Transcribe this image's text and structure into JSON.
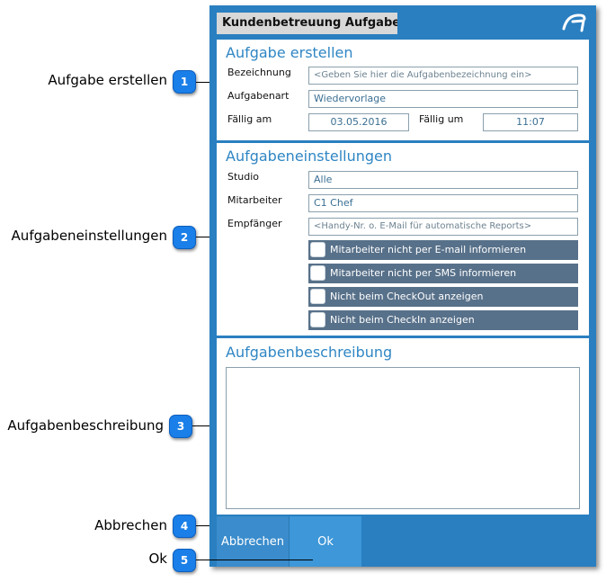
{
  "window": {
    "title": "Kundenbetreuung Aufgabe"
  },
  "callouts": [
    {
      "num": "1",
      "label": "Aufgabe erstellen"
    },
    {
      "num": "2",
      "label": "Aufgabeneinstellungen"
    },
    {
      "num": "3",
      "label": "Aufgabenbeschreibung"
    },
    {
      "num": "4",
      "label": "Abbrechen"
    },
    {
      "num": "5",
      "label": "Ok"
    }
  ],
  "create": {
    "heading": "Aufgabe erstellen",
    "bezeichnung_label": "Bezeichnung",
    "bezeichnung_placeholder": "<Geben Sie hier die Aufgabenbezeichnung ein>",
    "art_label": "Aufgabenart",
    "art_value": "Wiedervorlage",
    "faellig_am_label": "Fällig am",
    "faellig_am_value": "03.05.2016",
    "faellig_um_label": "Fällig um",
    "faellig_um_value": "11:07"
  },
  "settings": {
    "heading": "Aufgabeneinstellungen",
    "studio_label": "Studio",
    "studio_value": "Alle",
    "mitarbeiter_label": "Mitarbeiter",
    "mitarbeiter_value": "C1 Chef",
    "empfaenger_label": "Empfänger",
    "empfaenger_placeholder": "<Handy-Nr. o. E-Mail für automatische Reports>",
    "checkboxes": [
      {
        "label": "Mitarbeiter nicht per E-mail informieren",
        "checked": false
      },
      {
        "label": "Mitarbeiter nicht per SMS informieren",
        "checked": false
      },
      {
        "label": "Nicht beim CheckOut anzeigen",
        "checked": false
      },
      {
        "label": "Nicht beim CheckIn anzeigen",
        "checked": false
      }
    ]
  },
  "description": {
    "heading": "Aufgabenbeschreibung",
    "value": ""
  },
  "footer": {
    "cancel_label": "Abbrechen",
    "ok_label": "Ok"
  },
  "colors": {
    "frame": "#2a7fc0",
    "heading": "#2f86c4",
    "checkbox_row": "#58718a",
    "badge": "#1a7fe8"
  },
  "icons": {
    "logo": "app-logo-icon"
  }
}
